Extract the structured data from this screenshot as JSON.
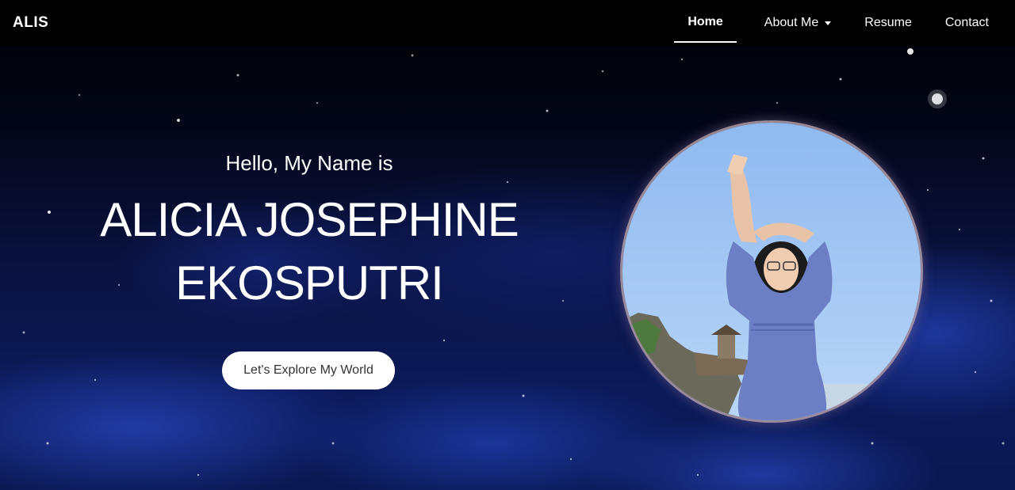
{
  "navbar": {
    "brand": "ALIS",
    "items": [
      {
        "label": "Home",
        "active": true
      },
      {
        "label": "About Me",
        "dropdown": true
      },
      {
        "label": "Resume"
      },
      {
        "label": "Contact"
      }
    ]
  },
  "hero": {
    "greeting": "Hello, My Name is",
    "name_line1": "ALICIA JOSEPHINE",
    "name_line2": "EKOSPUTRI",
    "cta_label": "Let's Explore My World"
  },
  "colors": {
    "nav_background": "#000000",
    "sky_blue": "#9ec4f2",
    "cta_background": "#ffffff",
    "cta_text": "#333333"
  },
  "icons": {
    "dropdown": "caret-down-icon"
  }
}
